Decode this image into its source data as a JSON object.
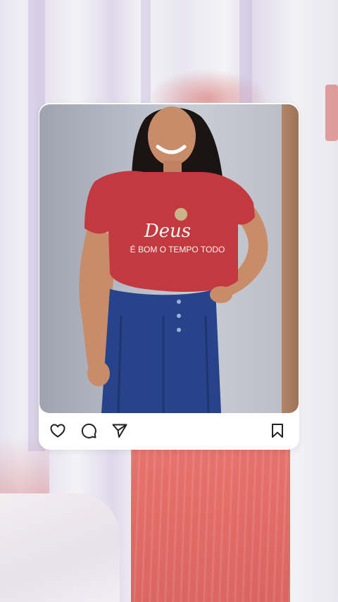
{
  "post": {
    "photo_alt": "",
    "actions": {
      "like": "heart-icon",
      "comment": "comment-icon",
      "share": "send-icon",
      "save": "bookmark-icon"
    },
    "shirt_text_line1": "Deus",
    "shirt_text_line2": "É BOM O TEMPO TODO"
  },
  "colors": {
    "card": "#ffffff",
    "icon": "#222222",
    "shirt": "#c23a3f",
    "skirt": "#27438a",
    "background_skirt": "#e3625c"
  }
}
